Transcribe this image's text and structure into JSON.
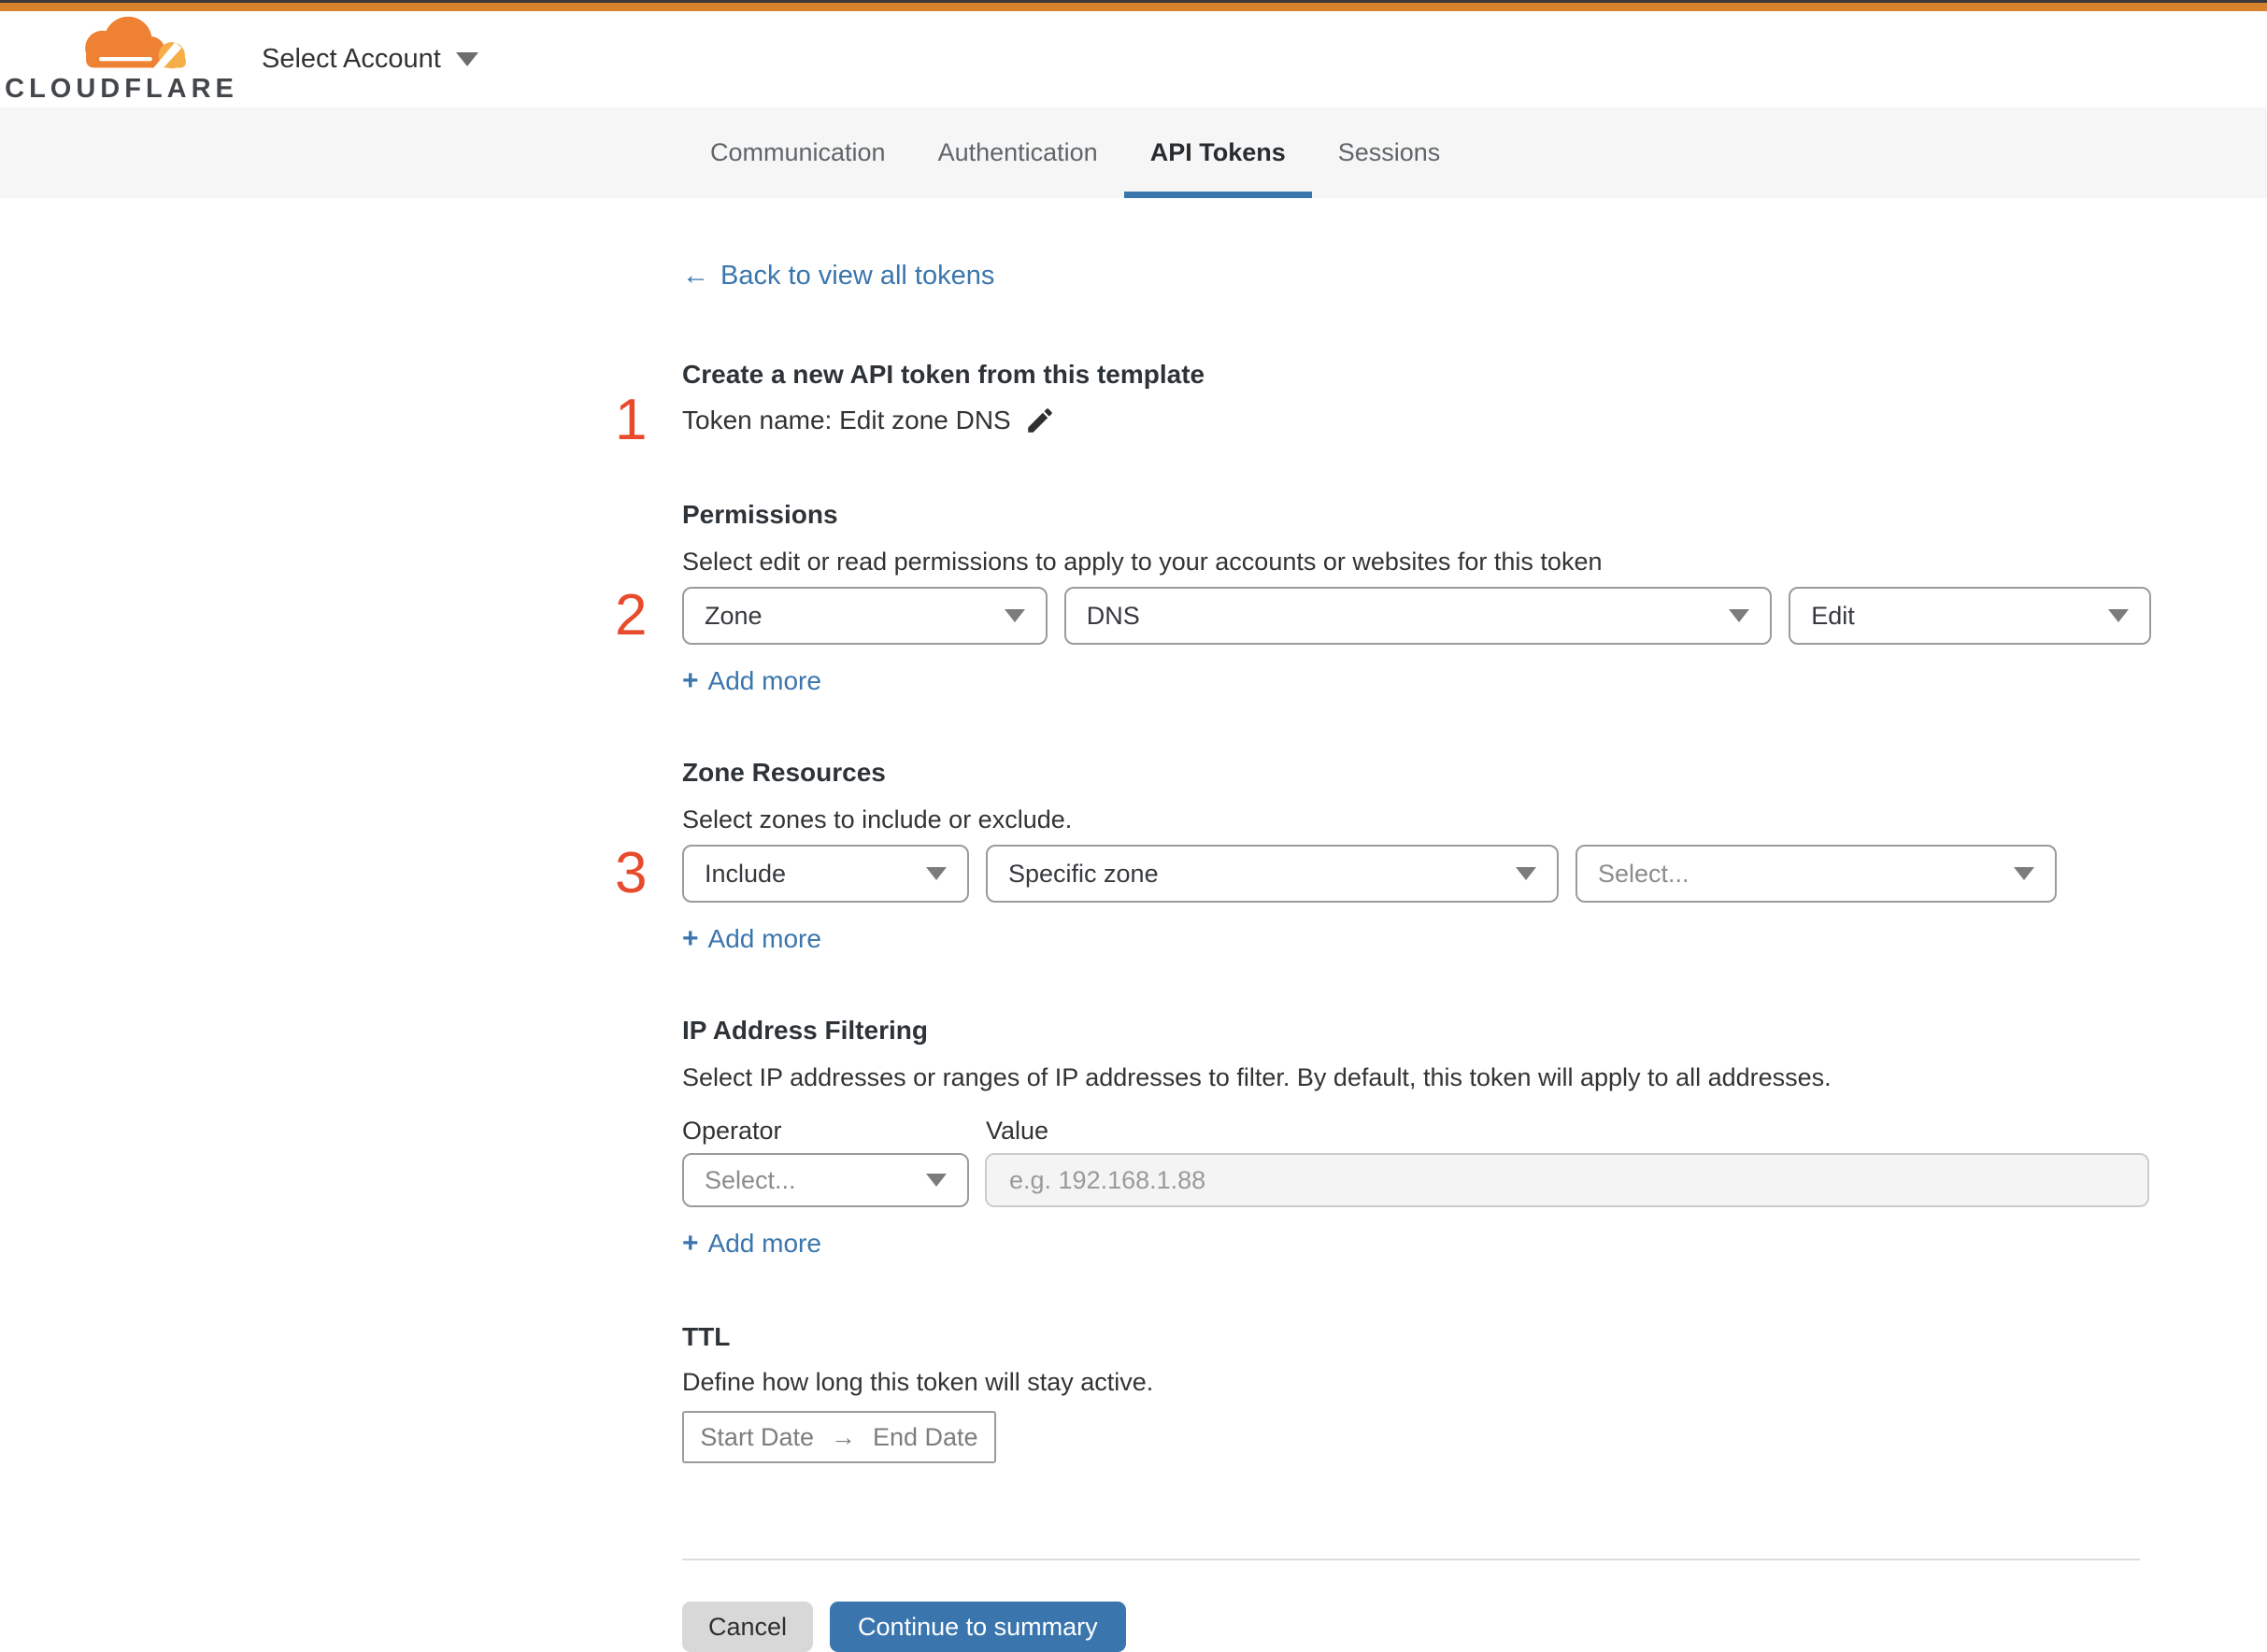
{
  "header": {
    "brand": "CLOUDFLARE",
    "account_selector": "Select Account"
  },
  "tabs": [
    {
      "label": "Communication",
      "active": false
    },
    {
      "label": "Authentication",
      "active": false
    },
    {
      "label": "API Tokens",
      "active": true
    },
    {
      "label": "Sessions",
      "active": false
    }
  ],
  "back_link": {
    "arrow": "←",
    "label": "Back to view all tokens"
  },
  "template_section": {
    "step": "1",
    "title": "Create a new API token from this template",
    "token_name": "Token name: Edit zone DNS"
  },
  "permissions": {
    "step": "2",
    "title": "Permissions",
    "description": "Select edit or read permissions to apply to your accounts or websites for this token",
    "dropdowns": [
      {
        "value": "Zone"
      },
      {
        "value": "DNS"
      },
      {
        "value": "Edit"
      }
    ],
    "add_more_plus": "+",
    "add_more": "Add more"
  },
  "zone_resources": {
    "step": "3",
    "title": "Zone Resources",
    "description": "Select zones to include or exclude.",
    "dropdowns": [
      {
        "value": "Include"
      },
      {
        "value": "Specific zone"
      },
      {
        "value": "Select..."
      }
    ],
    "add_more_plus": "+",
    "add_more": "Add more"
  },
  "ip_filtering": {
    "title": "IP Address Filtering",
    "description": "Select IP addresses or ranges of IP addresses to filter. By default, this token will apply to all addresses.",
    "operator_label": "Operator",
    "value_label": "Value",
    "operator_value": "Select...",
    "value_placeholder": "e.g. 192.168.1.88",
    "add_more_plus": "+",
    "add_more": "Add more"
  },
  "ttl": {
    "title": "TTL",
    "description": "Define how long this token will stay active.",
    "start_label": "Start Date",
    "arrow": "→",
    "end_label": "End Date"
  },
  "footer": {
    "cancel": "Cancel",
    "continue": "Continue to summary"
  },
  "colors": {
    "top_bar_orange": "#d9822e",
    "top_bar_dark": "#3a3a3a",
    "step_number_red": "#e84b2c",
    "link_blue": "#3a76ad",
    "button_blue": "#3a76ad",
    "tab_underline_blue": "#3a76ad",
    "logo_orange": "#ee8133",
    "logo_light_orange": "#f5ad48",
    "tabstrip_gray": "#f6f6f6"
  }
}
